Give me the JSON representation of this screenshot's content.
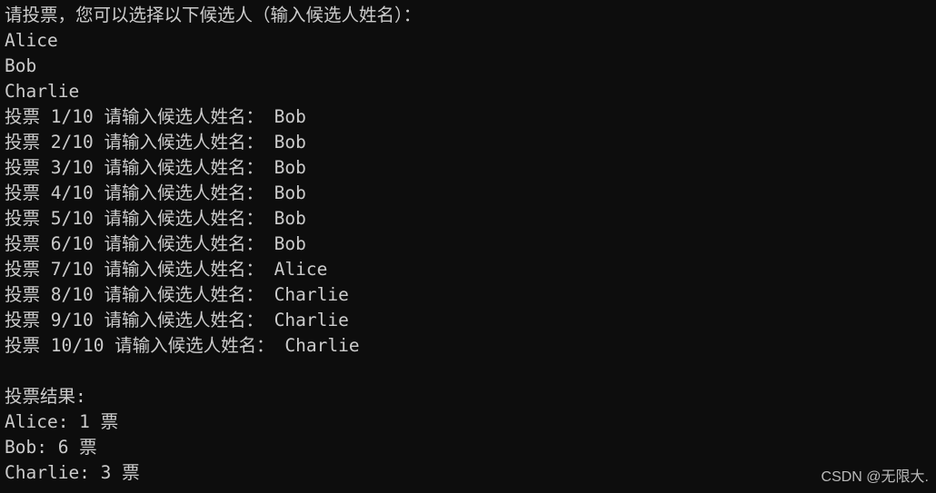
{
  "terminal": {
    "background_color": "#0d0d0d",
    "text_color": "#cccccc",
    "prompt_line": "请投票，您可以选择以下候选人（输入候选人姓名）：",
    "candidates": [
      "Alice",
      "Bob",
      "Charlie"
    ],
    "vote_lines": [
      "投票 1/10 请输入候选人姓名： Bob",
      "投票 2/10 请输入候选人姓名： Bob",
      "投票 3/10 请输入候选人姓名： Bob",
      "投票 4/10 请输入候选人姓名： Bob",
      "投票 5/10 请输入候选人姓名： Bob",
      "投票 6/10 请输入候选人姓名： Bob",
      "投票 7/10 请输入候选人姓名： Alice",
      "投票 8/10 请输入候选人姓名： Charlie",
      "投票 9/10 请输入候选人姓名： Charlie",
      "投票 10/10 请输入候选人姓名： Charlie"
    ],
    "blank_line": "",
    "results_header": "投票结果:",
    "results": [
      "Alice: 1 票",
      "Bob: 6 票",
      "Charlie: 3 票"
    ]
  },
  "watermark": {
    "text": "CSDN @无限大.",
    "color": "#b9b9b9"
  }
}
